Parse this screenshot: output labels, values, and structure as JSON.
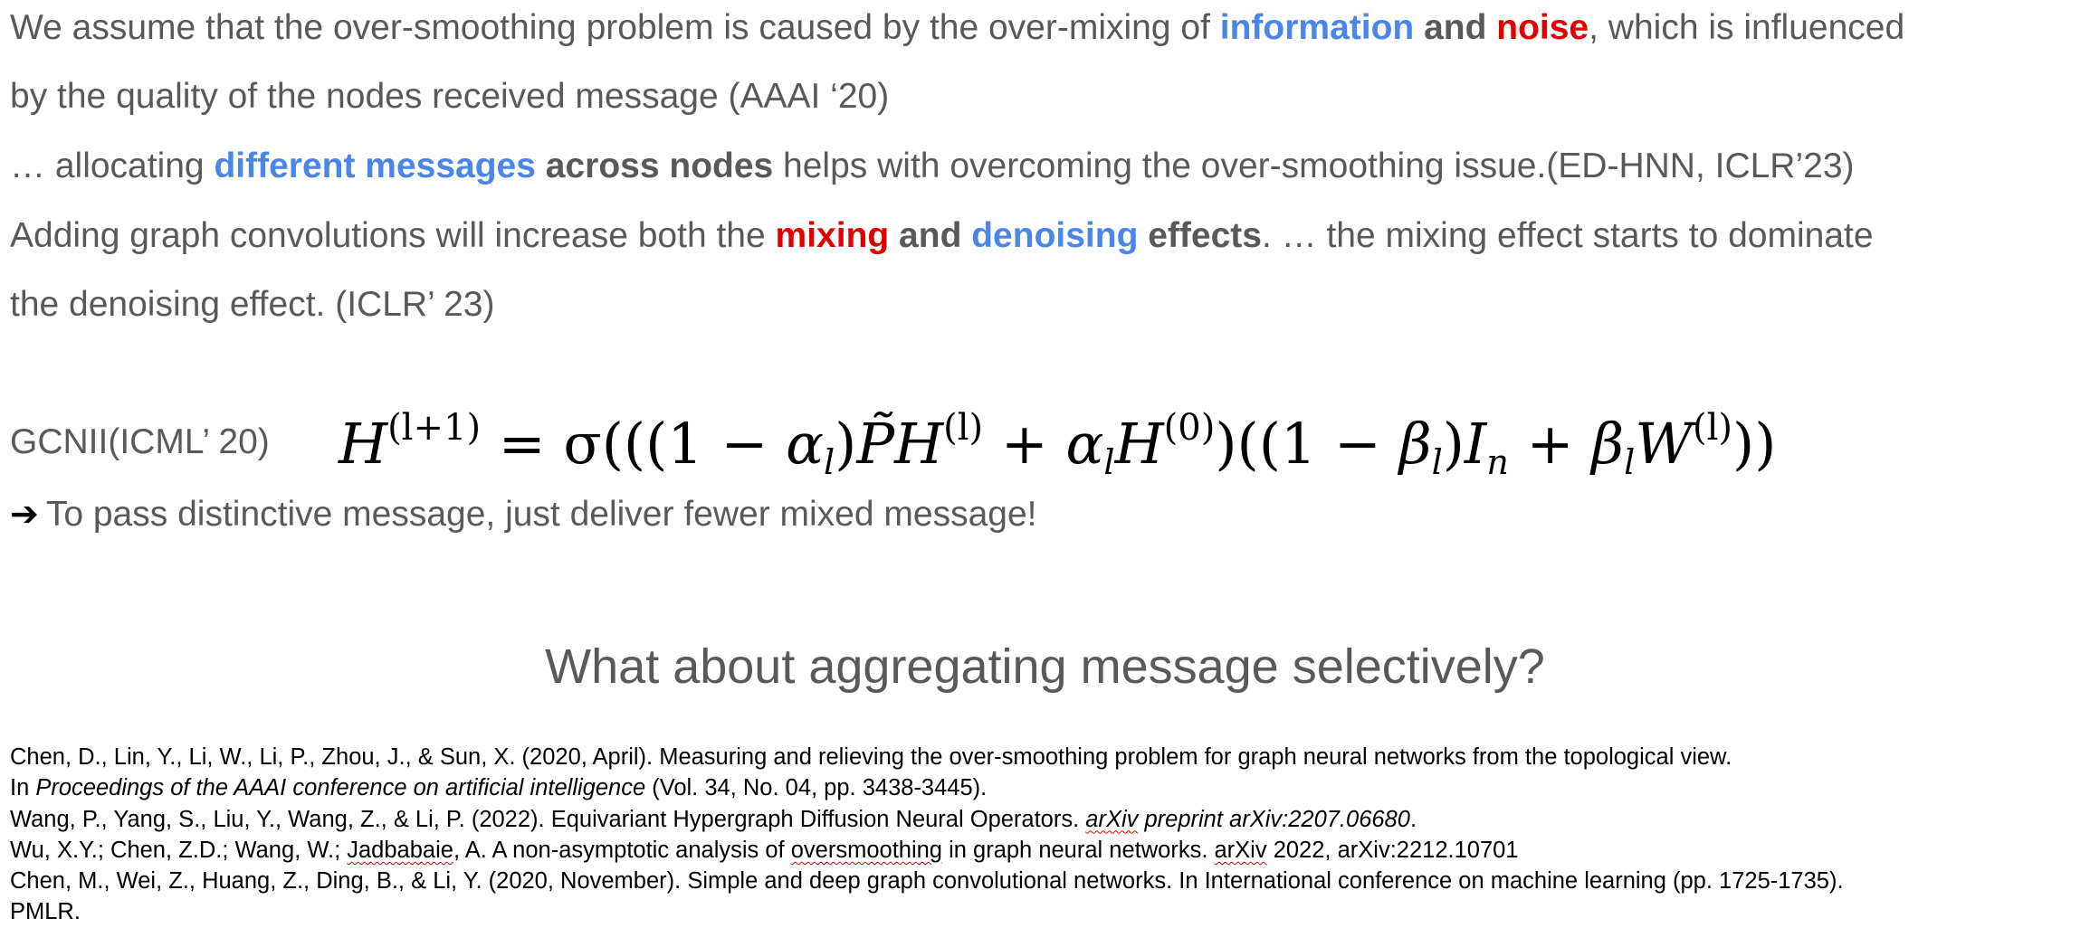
{
  "lines": {
    "l1": {
      "a": "We assume that the over-smoothing problem is caused by the over-mixing of ",
      "b": "information",
      "c": " and ",
      "d": "noise",
      "e": ", which is influenced"
    },
    "l2": {
      "a": "by the quality of the nodes received message (AAAI ‘20)"
    },
    "l3": {
      "a": "… allocating ",
      "b": "different messages",
      "c": " across nodes",
      "d": " helps with overcoming the over-smoothing issue.(ED-HNN, ICLR’23)"
    },
    "l4": {
      "a": "Adding graph convolutions will increase both the ",
      "b": "mixing",
      "c": " and ",
      "d": "denoising",
      "e": " effects",
      "f": ". … the mixing effect starts to dominate"
    },
    "l5": {
      "a": "the denoising effect. (ICLR’ 23)"
    }
  },
  "gcnii_label": "GCNII(ICML’ 20)",
  "formula": {
    "H": "H",
    "sup_l1": "(l+1)",
    "eq": " = σ(((1 − ",
    "alpha": "α",
    "sub_l": "l",
    "close1": ")",
    "P": "P̃",
    "sup_l": "(l)",
    "plus": " + ",
    "sup_0": "(0)",
    "mid": ")((1 − ",
    "beta": "β",
    "I": "I",
    "sub_n": "n",
    "W": "W",
    "end": "))"
  },
  "arrow_text": "To pass distinctive message, just deliver fewer mixed message!",
  "arrow_icon": "arrow-right-icon",
  "question": "What about aggregating message selectively?",
  "refs": {
    "r1": "Chen, D., Lin, Y., Li, W., Li, P., Zhou, J., & Sun, X. (2020, April). Measuring and relieving the over-smoothing problem for graph neural networks from the topological view.",
    "r2a": "In ",
    "r2b": "Proceedings of the AAAI conference on artificial intelligence",
    "r2c": " (Vol. 34, No. 04, pp. 3438-3445).",
    "r3a": "Wang, P., Yang, S., Liu, Y., Wang, Z., & Li, P. (2022). Equivariant Hypergraph Diffusion Neural Operators. ",
    "r3b": "arXiv",
    "r3c": " preprint arXiv:2207.06680",
    "r3d": ".",
    "r4a": "Wu, X.Y.; Chen, Z.D.; Wang, W.; ",
    "r4b": "Jadbabaie",
    "r4c": ", A. A non-asymptotic analysis of ",
    "r4d": "oversmoothing",
    "r4e": " in graph neural networks. ",
    "r4f": "arXiv",
    "r4g": " 2022, arXiv:2212.10701",
    "r5": "Chen, M., Wei, Z., Huang, Z., Ding, B., & Li, Y. (2020, November). Simple and deep graph convolutional networks. In International conference on machine learning (pp. 1725-1735).",
    "r6": "PMLR."
  },
  "colors": {
    "text": "#595959",
    "blue": "#4a86e8",
    "red": "#e00000"
  }
}
